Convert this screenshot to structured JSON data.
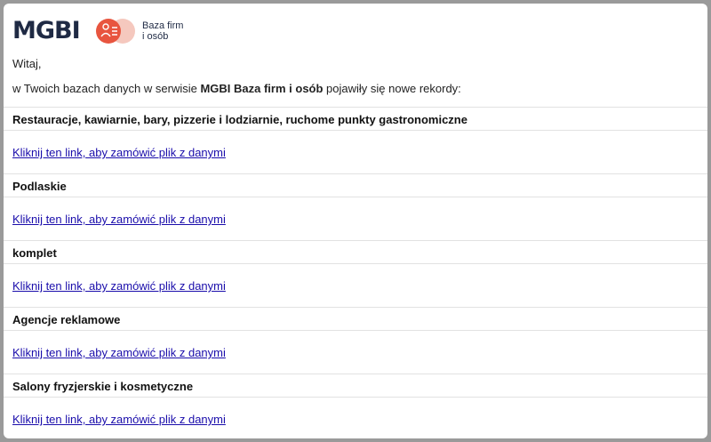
{
  "brand": {
    "logo": "MGBI",
    "sub_line1": "Baza firm",
    "sub_line2": "i osób",
    "accent": "#e8553f"
  },
  "greeting": "Witaj,",
  "intro": {
    "before": "w Twoich bazach danych w serwisie ",
    "brand_bold": "MGBI Baza firm i osób",
    "after": " pojawiły się nowe rekordy:"
  },
  "sections": [
    {
      "title": "Restauracje, kawiarnie, bary, pizzerie i lodziarnie, ruchome punkty gastronomiczne",
      "link": "Kliknij ten link, aby zamówić plik z danymi"
    },
    {
      "title": "Podlaskie",
      "link": "Kliknij ten link, aby zamówić plik z danymi"
    },
    {
      "title": "komplet",
      "link": "Kliknij ten link, aby zamówić plik z danymi"
    },
    {
      "title": "Agencje reklamowe",
      "link": "Kliknij ten link, aby zamówić plik z danymi"
    },
    {
      "title": "Salony fryzjerskie i kosmetyczne",
      "link": "Kliknij ten link, aby zamówić plik z danymi"
    }
  ]
}
